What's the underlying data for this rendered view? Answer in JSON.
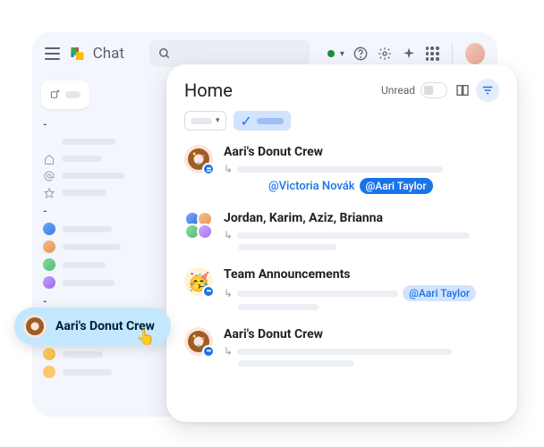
{
  "app_name": "Chat",
  "panel": {
    "title": "Home",
    "unread_label": "Unread"
  },
  "conversations": [
    {
      "title": "Aari's Donut Crew",
      "mention_link": "@Victoria Novák",
      "mention_chip_solid": "@Aari Taylor"
    },
    {
      "title": "Jordan, Karim, Aziz, Brianna"
    },
    {
      "title": "Team Announcements",
      "mention_chip_light": "@Aari Taylor"
    },
    {
      "title": "Aari's Donut Crew"
    }
  ],
  "hover_tooltip": "Aari's Donut Crew",
  "sidebar": {
    "section_dash": "-"
  }
}
